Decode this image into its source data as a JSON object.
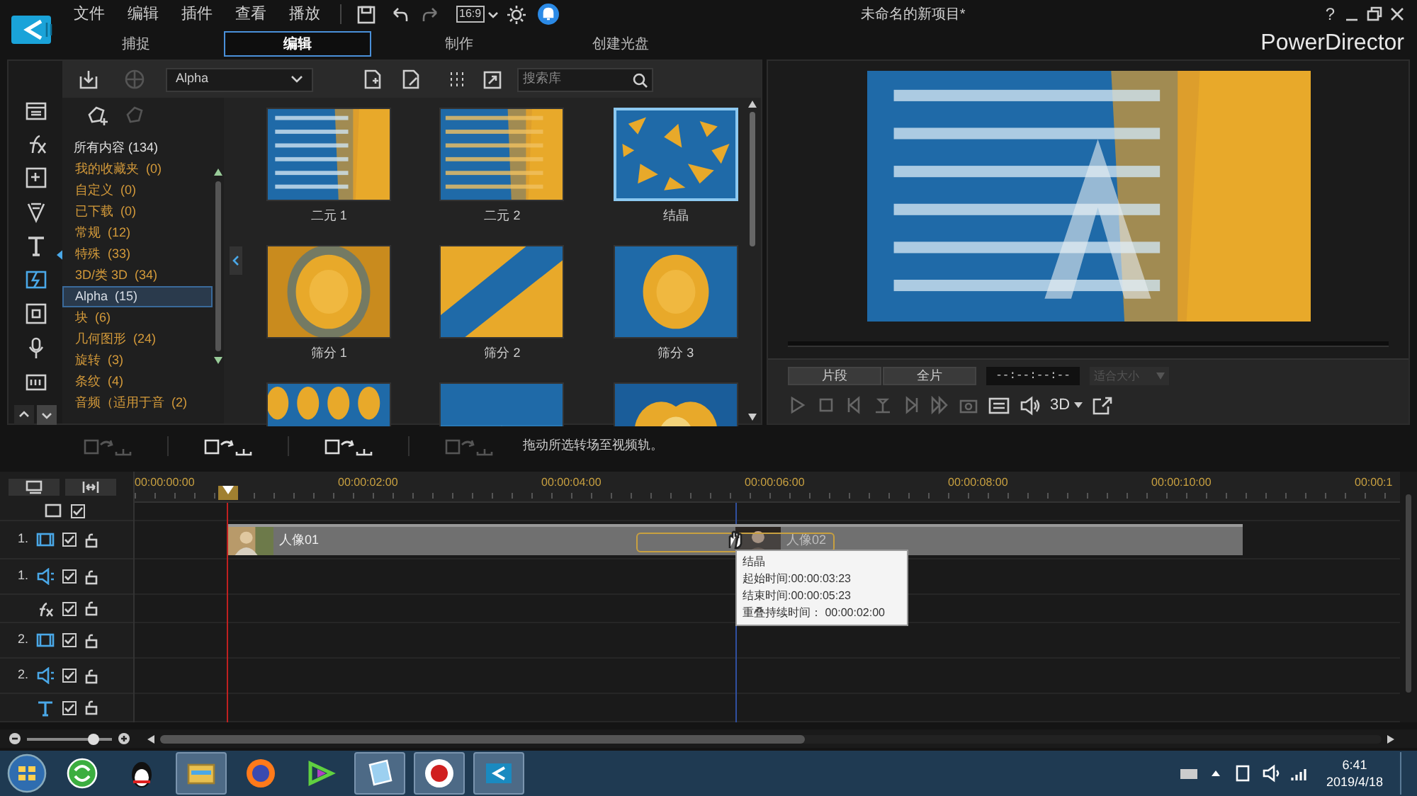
{
  "menu": [
    "文件",
    "编辑",
    "插件",
    "查看",
    "播放"
  ],
  "aspect": "16:9",
  "project_title": "未命名的新项目*",
  "help": "?",
  "app_name": "PowerDirector",
  "tabs": [
    {
      "label": "捕捉",
      "selected": false
    },
    {
      "label": "编辑",
      "selected": true
    },
    {
      "label": "制作",
      "selected": false
    },
    {
      "label": "创建光盘",
      "selected": false
    }
  ],
  "library": {
    "filter": "Alpha",
    "search_placeholder": "搜索库",
    "all_items": {
      "label": "所有内容",
      "count": "(134)"
    },
    "categories": [
      {
        "label": "我的收藏夹",
        "count": "(0)",
        "selected": false
      },
      {
        "label": "自定义",
        "count": "(0)",
        "selected": false
      },
      {
        "label": "已下载",
        "count": "(0)",
        "selected": false
      },
      {
        "label": "常规",
        "count": "(12)",
        "selected": false
      },
      {
        "label": "特殊",
        "count": "(33)",
        "selected": false
      },
      {
        "label": "3D/类 3D",
        "count": "(34)",
        "selected": false
      },
      {
        "label": "Alpha",
        "count": "(15)",
        "selected": true
      },
      {
        "label": "块",
        "count": "(6)",
        "selected": false
      },
      {
        "label": "几何图形",
        "count": "(24)",
        "selected": false
      },
      {
        "label": "旋转",
        "count": "(3)",
        "selected": false
      },
      {
        "label": "条纹",
        "count": "(4)",
        "selected": false
      },
      {
        "label": "音频（适用于音",
        "count": "(2)",
        "selected": false
      }
    ],
    "thumbnails": [
      {
        "kind": "binary",
        "label": "二元 1",
        "selected": false
      },
      {
        "kind": "binary2",
        "label": "二元 2",
        "selected": false
      },
      {
        "kind": "shards",
        "label": "结晶",
        "selected": true
      },
      {
        "kind": "halftone",
        "label": "筛分 1",
        "selected": false
      },
      {
        "kind": "diagonal",
        "label": "筛分 2",
        "selected": false
      },
      {
        "kind": "burst",
        "label": "筛分 3",
        "selected": false
      },
      {
        "kind": "drops",
        "selected": false
      },
      {
        "kind": "speckle",
        "selected": false
      },
      {
        "kind": "rings",
        "selected": false
      }
    ]
  },
  "transition_hint": "拖动所选转场至视频轨。",
  "preview": {
    "modes": [
      "片段",
      "全片"
    ],
    "timecode": "--:--:--:--",
    "fit": {
      "label": "适合大小",
      "disabled": true
    },
    "stereo": "3D"
  },
  "timeline": {
    "ruler": [
      "00:00:00:00",
      "00:00:02:00",
      "00:00:04:00",
      "00:00:06:00",
      "00:00:08:00",
      "00:00:10:00",
      "00:00:1"
    ],
    "tracks": [
      {
        "kind": "master",
        "checked": true
      },
      {
        "kind": "video",
        "number": "1.",
        "checked": true
      },
      {
        "kind": "audio",
        "number": "1.",
        "checked": true
      },
      {
        "kind": "fx",
        "checked": true
      },
      {
        "kind": "video",
        "number": "2.",
        "checked": true
      },
      {
        "kind": "audio",
        "number": "2.",
        "checked": true
      },
      {
        "kind": "title",
        "checked": true
      }
    ],
    "clips": [
      {
        "label": "人像01"
      },
      {
        "label": "人像02"
      }
    ],
    "tooltip": {
      "title": "结晶",
      "lines": [
        "起始时间:00:00:03:23",
        "结束时间:00:00:05:23",
        "重叠持续时间： 00:00:02:00"
      ]
    },
    "zoom": {
      "level": 0.78
    }
  },
  "clock": {
    "time": "6:41",
    "date": "2019/4/18"
  }
}
